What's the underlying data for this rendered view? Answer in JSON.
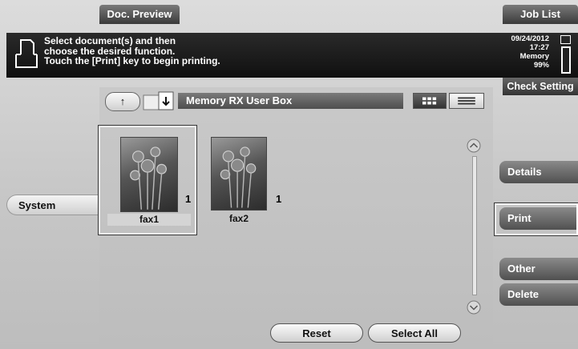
{
  "tabs": {
    "doc_preview": "Doc. Preview",
    "job_list": "Job List"
  },
  "message": {
    "line1": "Select document(s) and then",
    "line2": "choose the desired function.",
    "line3": "Touch the [Print] key to begin printing."
  },
  "status": {
    "date": "09/24/2012",
    "time": "17:27",
    "memory_label": "Memory",
    "memory_value": "99%"
  },
  "right_buttons": {
    "check_setting": "Check Setting",
    "details": "Details",
    "print": "Print",
    "other": "Other",
    "delete": "Delete"
  },
  "left": {
    "system": "System"
  },
  "box": {
    "title": "Memory RX User Box",
    "up_symbol": "↑"
  },
  "documents": [
    {
      "name": "fax1",
      "pages": "1",
      "selected": true
    },
    {
      "name": "fax2",
      "pages": "1",
      "selected": false
    }
  ],
  "bottom": {
    "reset": "Reset",
    "select_all": "Select All"
  },
  "icons": {
    "document": "document-icon",
    "memory": "memory-icon",
    "box": "box-icon",
    "thumbnail_view": "thumbnail-view-icon",
    "list_view": "list-view-icon",
    "scroll_up": "scroll-up-icon",
    "scroll_down": "scroll-down-icon"
  },
  "colors": {
    "message_bar": "#151515",
    "panel": "#c4c4c4",
    "button_dark": "#505050"
  }
}
